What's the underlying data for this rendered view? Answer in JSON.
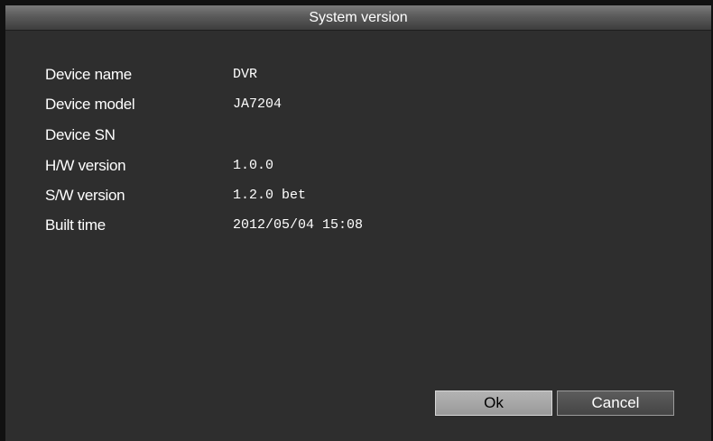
{
  "dialog": {
    "title": "System version"
  },
  "info": [
    {
      "label": "Device name",
      "value": "DVR"
    },
    {
      "label": "Device model",
      "value": "JA7204"
    },
    {
      "label": "Device SN",
      "value": ""
    },
    {
      "label": "H/W version",
      "value": "1.0.0"
    },
    {
      "label": "S/W version",
      "value": "1.2.0 bet"
    },
    {
      "label": "Built time",
      "value": "2012/05/04 15:08"
    }
  ],
  "buttons": {
    "ok_label": "Ok",
    "cancel_label": "Cancel"
  },
  "colors": {
    "dialog_background": "#2e2e2e",
    "text": "#ffffff",
    "ok_button": "#a8a8a8",
    "cancel_button": "#505050"
  }
}
